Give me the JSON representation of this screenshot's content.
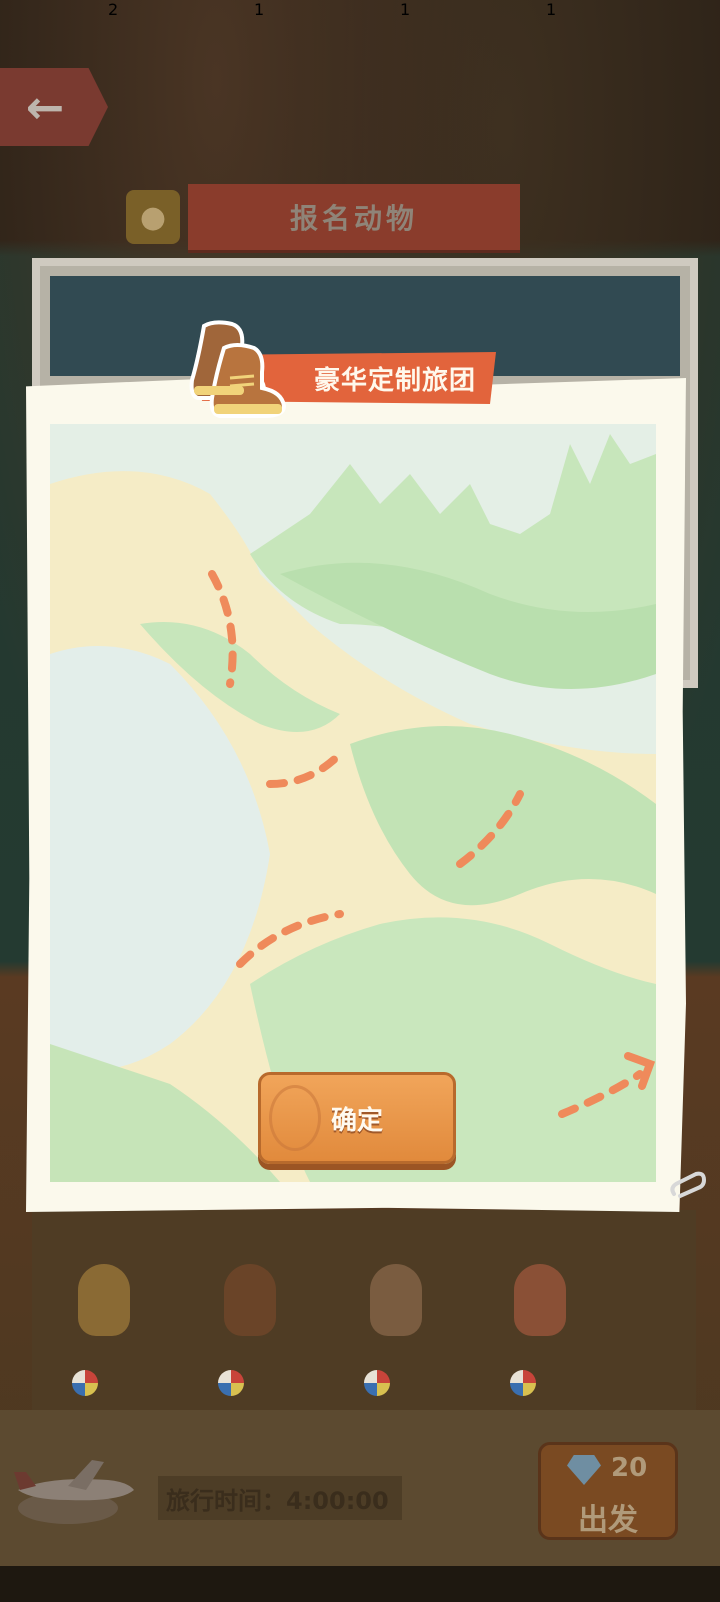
{
  "header": {
    "title": "报名动物"
  },
  "modal": {
    "ribbon_title": "豪华定制旅团",
    "confirm_label": "确定"
  },
  "animals": [
    {
      "name": "shiba",
      "count": "2",
      "color": "#d79a3a"
    },
    {
      "name": "bear",
      "count": "1",
      "color": "#9a5a34"
    },
    {
      "name": "rabbit",
      "count": "1",
      "color": "#b98a62"
    },
    {
      "name": "mouse-girl",
      "count": "1",
      "color": "#e0805a"
    }
  ],
  "footer": {
    "travel_time_label": "旅行时间：4:00:00",
    "gem_cost": "20",
    "go_label": "出发"
  },
  "colors": {
    "ribbon": "#e2643c",
    "confirm": "#e8953f",
    "map_land": "#cfe8c2",
    "map_water": "#e3eeea",
    "route": "#ef8a5b"
  }
}
